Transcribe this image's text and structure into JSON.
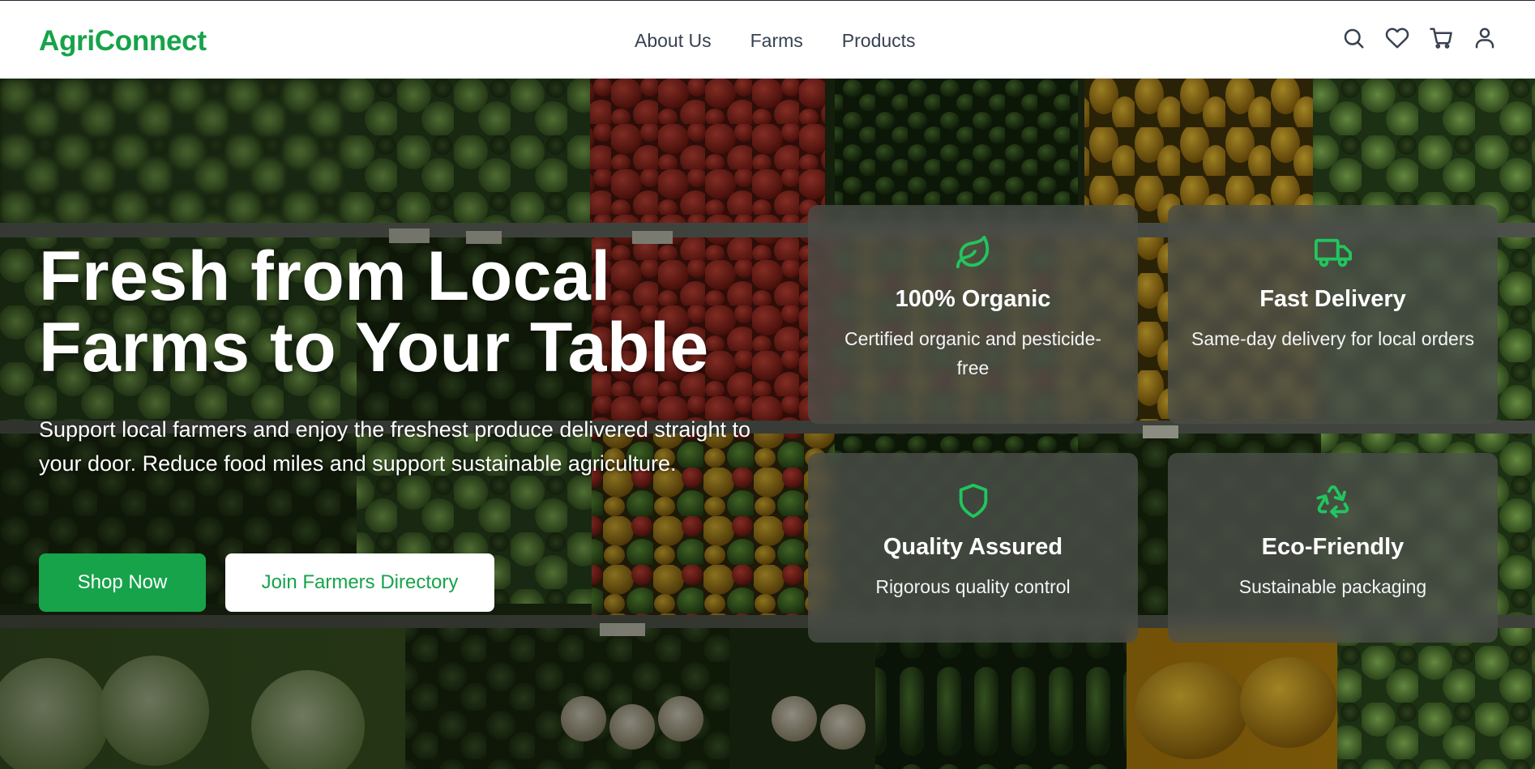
{
  "header": {
    "logo": "AgriConnect",
    "nav": [
      "About Us",
      "Farms",
      "Products"
    ],
    "icons": [
      "search-icon",
      "heart-icon",
      "cart-icon",
      "user-icon"
    ]
  },
  "hero": {
    "title_line1": "Fresh from Local",
    "title_line2": "Farms to Your Table",
    "subtitle": "Support local farmers and enjoy the freshest produce delivered straight to your door. Reduce food miles and support sustainable agriculture.",
    "primary_button": "Shop Now",
    "secondary_button": "Join Farmers Directory"
  },
  "features": [
    {
      "icon": "leaf-icon",
      "title": "100% Organic",
      "desc": "Certified organic and pesticide-free"
    },
    {
      "icon": "truck-icon",
      "title": "Fast Delivery",
      "desc": "Same-day delivery for local orders"
    },
    {
      "icon": "shield-icon",
      "title": "Quality Assured",
      "desc": "Rigorous quality control"
    },
    {
      "icon": "recycle-icon",
      "title": "Eco-Friendly",
      "desc": "Sustainable packaging"
    }
  ],
  "colors": {
    "brand": "#16a34a",
    "icon_accent": "#22c55e",
    "card_bg": "rgba(75,80,74,0.78)"
  }
}
